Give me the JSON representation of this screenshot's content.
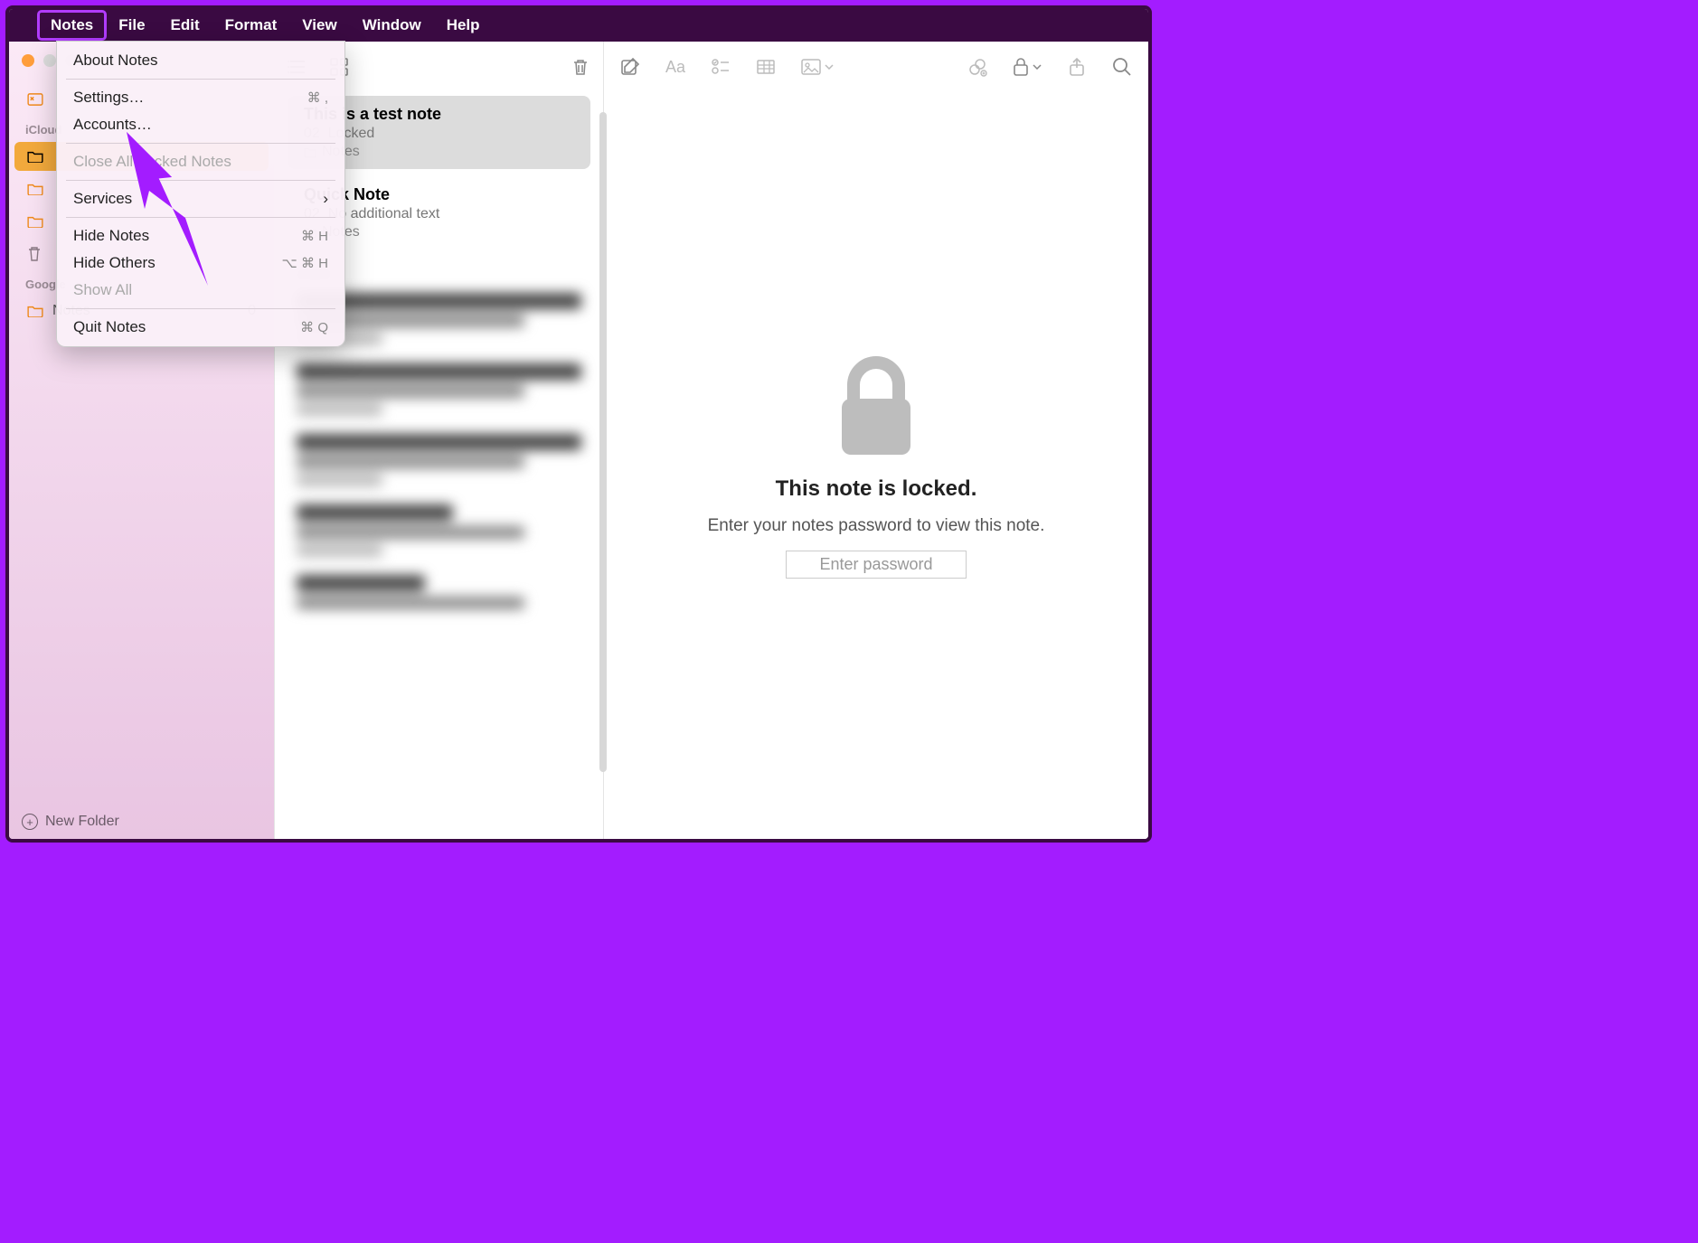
{
  "menubar": {
    "items": [
      "Notes",
      "File",
      "Edit",
      "Format",
      "View",
      "Window",
      "Help"
    ],
    "highlighted": "Notes"
  },
  "dropdown": {
    "about": "About Notes",
    "settings": "Settings…",
    "settings_sc": "⌘ ,",
    "accounts": "Accounts…",
    "close_locked": "Close All Locked Notes",
    "services": "Services",
    "hide_notes": "Hide Notes",
    "hide_notes_sc": "⌘ H",
    "hide_others": "Hide Others",
    "hide_others_sc": "⌥ ⌘ H",
    "show_all": "Show All",
    "quit": "Quit Notes",
    "quit_sc": "⌘ Q"
  },
  "sidebar": {
    "sections": {
      "icloud": "iCloud",
      "google": "Google"
    },
    "icloud_items": [
      {
        "label": "",
        "count": ""
      },
      {
        "label": "",
        "count": ""
      },
      {
        "label": "",
        "count": ""
      }
    ],
    "google_items": [
      {
        "label": "Notes",
        "count": "0"
      }
    ],
    "new_folder": "New Folder"
  },
  "notes": [
    {
      "title": "This is a test note",
      "time": "02",
      "meta": "Locked",
      "folder": "Notes",
      "selected": true
    },
    {
      "title": "Quick Note",
      "time": "02",
      "meta": "No additional text",
      "folder": "Notes",
      "selected": false
    }
  ],
  "main": {
    "locked_title": "This note is locked.",
    "locked_sub": "Enter your notes password to view this note.",
    "enter_pw": "Enter password"
  }
}
